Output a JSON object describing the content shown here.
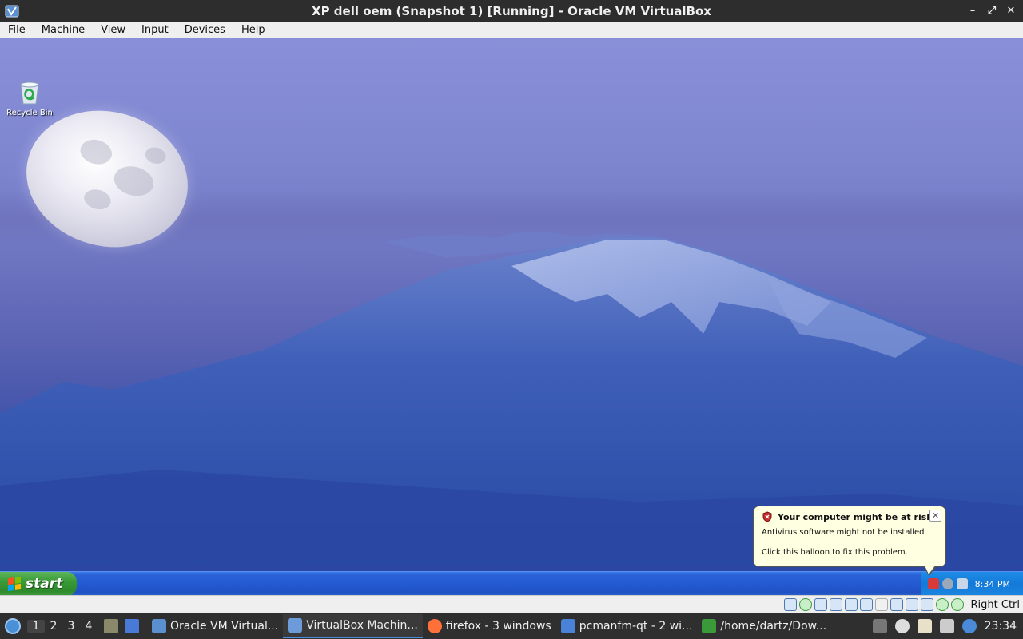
{
  "window": {
    "title": "XP dell oem (Snapshot 1) [Running] - Oracle VM VirtualBox",
    "controls": [
      "–",
      "⤢",
      "✕"
    ]
  },
  "menubar": [
    "File",
    "Machine",
    "View",
    "Input",
    "Devices",
    "Help"
  ],
  "desktop": {
    "icons": [
      {
        "label": "Recycle Bin",
        "icon": "recycle-bin-icon"
      }
    ]
  },
  "balloon": {
    "title": "Your computer might be at risk",
    "line1": "Antivirus software might not be installed",
    "line2": "Click this balloon to fix this problem.",
    "close": "✕"
  },
  "xp_taskbar": {
    "start_label": "start",
    "clock": "8:34 PM"
  },
  "vbox_status": {
    "host_key": "Right Ctrl"
  },
  "host_panel": {
    "workspaces": [
      "1",
      "2",
      "3",
      "4"
    ],
    "active_workspace": "1",
    "tasks": [
      {
        "label": "Oracle VM Virtual...",
        "icon": "virtualbox-icon",
        "active": false
      },
      {
        "label": "VirtualBox Machin...",
        "icon": "virtualbox-machine-icon",
        "active": true
      },
      {
        "label": "firefox - 3 windows",
        "icon": "firefox-icon",
        "active": false
      },
      {
        "label": "pcmanfm-qt - 2 wi...",
        "icon": "folder-icon",
        "active": false
      },
      {
        "label": "/home/dartz/Dow...",
        "icon": "terminal-icon",
        "active": false
      }
    ],
    "clock": "23:34"
  },
  "colors": {
    "xp_taskbar": "#245ad2",
    "start_button": "#3b9a38",
    "balloon_bg": "#ffffe1",
    "host_panel": "#2f2f2f",
    "active_accent": "#4a90d9"
  }
}
